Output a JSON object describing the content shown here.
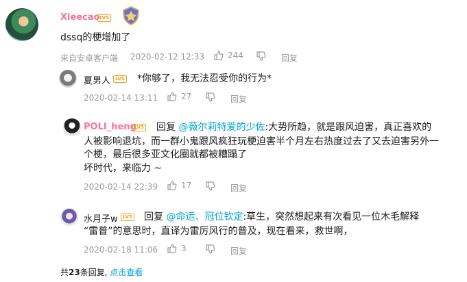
{
  "main": {
    "username": "Xieecao",
    "level": "LV5",
    "content": "dssq的梗增加了",
    "source": "来自安卓客户端",
    "time": "2020-02-12 12:33",
    "likes": "244",
    "reply_label": "回复"
  },
  "replies": [
    {
      "username": "夏男人",
      "level": "LV5",
      "content": "*你够了，我无法忍受你的行为*",
      "time": "2020-02-14 13:11",
      "likes": "27",
      "reply_label": "回复"
    },
    {
      "username": "POLI_heng",
      "level": "LV5",
      "reply_prefix": "回复",
      "mention": "@薇尔莉特爱的少佐",
      "content_line1": ":大势所趋，就是跟风迫害，真正喜欢的",
      "content_line2": "人被影响退坑，而一群小鬼跟风疯狂玩梗迫害半个月左右热度过去了又去迫害另外一",
      "content_line3": "个梗，最后很多亚文化圈就都被糟蹋了",
      "content_line4": "坏时代，来临力 ~",
      "time": "2020-02-14 22:39",
      "likes": "17",
      "reply_label": "回复"
    },
    {
      "username": "水月子w",
      "level": "LV5",
      "reply_prefix": "回复",
      "mention": "@命运、冠位钦定",
      "content_line1": ":草生，突然想起来有次看见一位木毛解释",
      "content_line2": "“雷普”的意思时，直译为雷厉风行的普及，现在看来，救世啊，",
      "time": "2020-02-18 11:06",
      "likes": "3",
      "reply_label": "回复"
    }
  ],
  "footer": {
    "total_prefix": "共",
    "total_count": "23",
    "total_suffix": "条回复,",
    "view_link": "点击查看"
  },
  "colors": {
    "username": "#fb7299",
    "link": "#00a1d6",
    "meta": "#9499a0"
  }
}
